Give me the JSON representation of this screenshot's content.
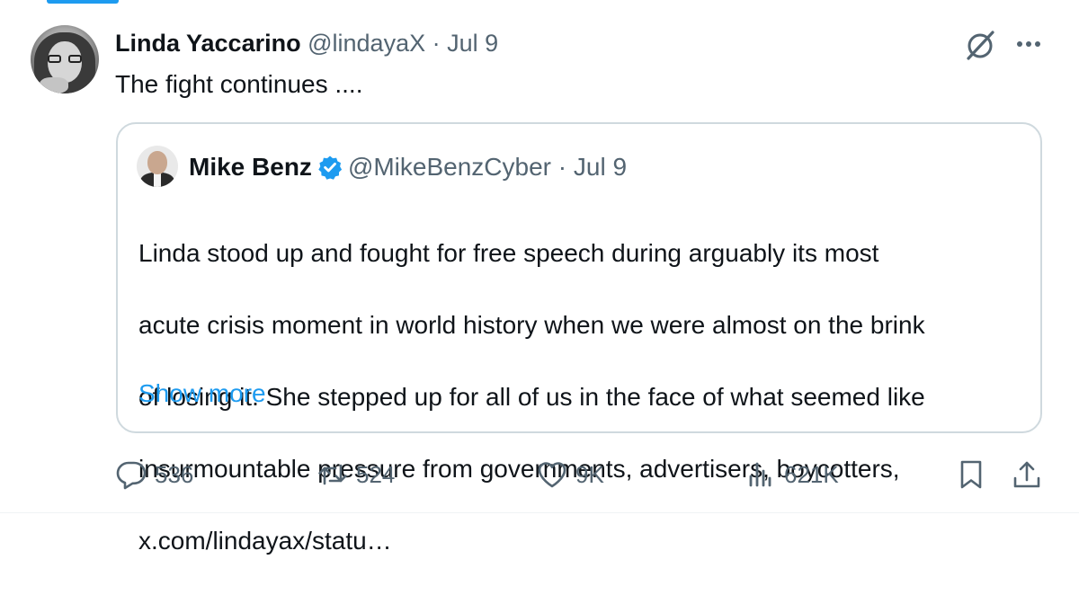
{
  "tweet": {
    "author_name": "Linda Yaccarino",
    "author_handle": "@lindayaX",
    "separator": "·",
    "date": "Jul 9",
    "text": "The fight continues ...."
  },
  "quoted": {
    "author_name": "Mike Benz",
    "author_handle": "@MikeBenzCyber",
    "separator": "·",
    "date": "Jul 9",
    "text_lines": [
      "Linda stood up and fought for free speech during arguably its most",
      "acute crisis moment in world history when we were almost on the brink",
      "of losing it. She stepped up for all of us in the face of what seemed like",
      "insurmountable pressure from governments, advertisers, boycotters,",
      "x.com/lindayax/statu…"
    ],
    "show_more": "Show more",
    "verified_color": "#1d9bf0"
  },
  "actions": {
    "replies": "536",
    "reposts": "524",
    "likes": "9K",
    "views": "621K"
  },
  "icons": [
    "grok-icon",
    "more-options-icon",
    "reply-icon",
    "repost-icon",
    "like-icon",
    "views-icon",
    "bookmark-icon",
    "share-icon",
    "verified-badge-icon"
  ],
  "colors": {
    "accent": "#1d9bf0",
    "muted": "#536471",
    "text": "#0f1419",
    "border": "#cfd9de"
  }
}
